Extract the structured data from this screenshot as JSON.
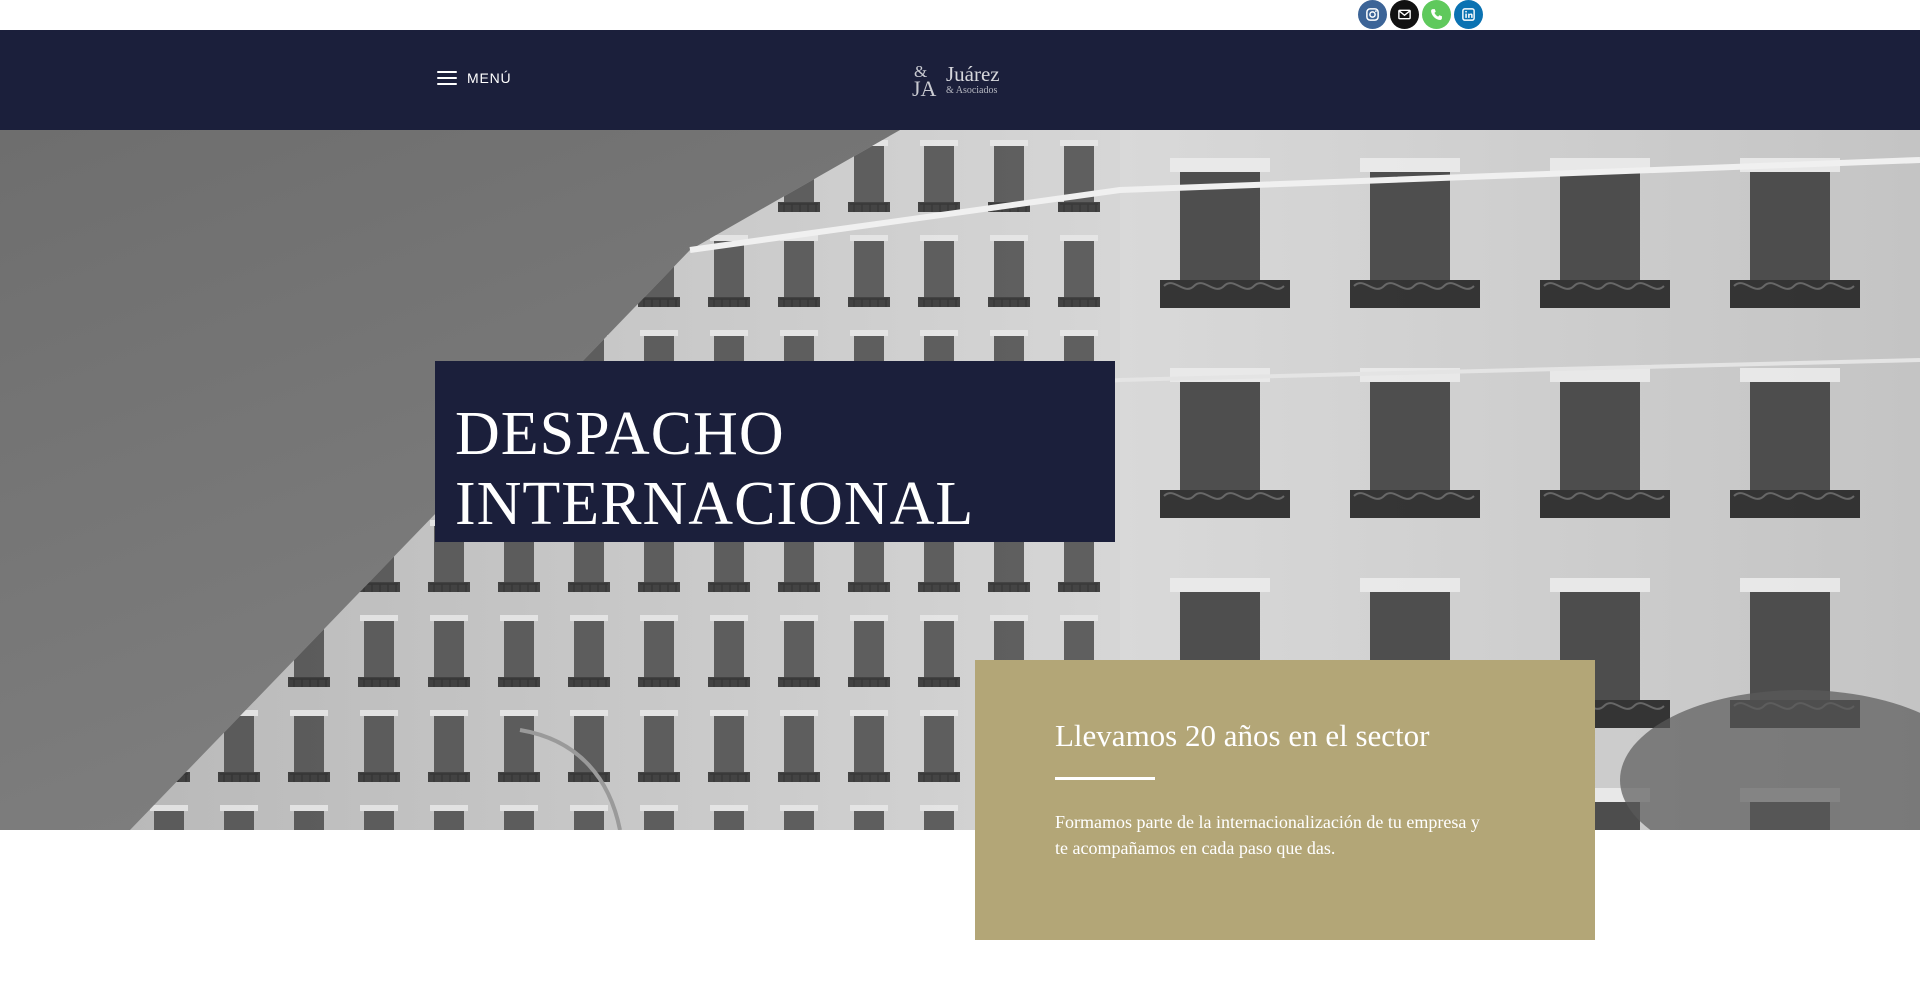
{
  "colors": {
    "navy": "#1b1f3b",
    "gold": "#b3a677",
    "instagram": "#3c6497",
    "email": "#111111",
    "phone": "#5fc95c",
    "linkedin": "#0a72b2"
  },
  "social": [
    {
      "name": "instagram-icon"
    },
    {
      "name": "email-icon"
    },
    {
      "name": "phone-icon"
    },
    {
      "name": "linkedin-icon"
    }
  ],
  "header": {
    "menu_label": "MENÚ",
    "logo_name": "Juárez",
    "logo_sub": "& Asociados"
  },
  "hero": {
    "title_line1": "DESPACHO",
    "title_line2": "INTERNACIONAL"
  },
  "info": {
    "heading": "Llevamos 20 años en el sector",
    "text": "Formamos parte de la internacionalización de tu empresa y te acompañamos en cada paso que das."
  }
}
